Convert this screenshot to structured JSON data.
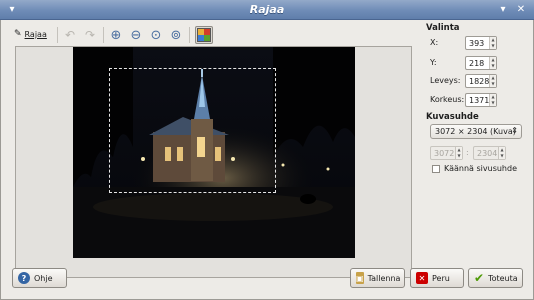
{
  "window": {
    "title": "Rajaa",
    "menu_icon": "window-menu-icon",
    "minimize_icon": "minimize-icon",
    "close_icon": "close-icon"
  },
  "toolbar": {
    "tool_label": "Rajaa",
    "tool_icon": "crop-pen-icon",
    "icons": [
      "undo-icon",
      "redo-icon",
      "zoom-in-icon",
      "zoom-out-icon",
      "zoom-fit-icon",
      "zoom-normal-icon",
      "show-crop-guides-icon"
    ]
  },
  "selection": {
    "heading": "Valinta",
    "x_label": "X:",
    "x_value": "393",
    "y_label": "Y:",
    "y_value": "218",
    "width_label": "Leveys:",
    "width_value": "1828",
    "height_label": "Korkeus:",
    "height_value": "1371"
  },
  "aspect": {
    "heading": "Kuvasuhde",
    "ratio_value": "3072 × 2304 (Kuva)",
    "ratio_w": "3072",
    "ratio_h": "2304",
    "swap_label": "Käännä sivusuhde",
    "swap_checked": false
  },
  "buttons": {
    "help": "Ohje",
    "save": "Tallenna",
    "cancel": "Peru",
    "apply": "Toteuta"
  },
  "colors": {
    "titlebar": "#6f8cb7",
    "window_bg": "#edebe7",
    "apply_icon": "#4e9a06",
    "cancel_icon": "#cc0000",
    "help_icon": "#3465a4"
  }
}
